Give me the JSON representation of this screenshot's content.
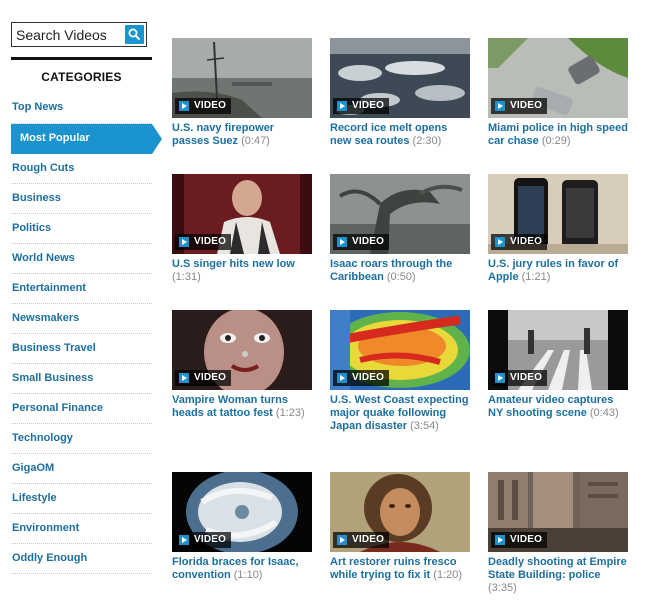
{
  "search": {
    "placeholder": "Search Videos",
    "icon": "search-icon"
  },
  "categories": {
    "title": "CATEGORIES",
    "items": [
      {
        "label": "Top News"
      },
      {
        "label": "Most Popular",
        "active": true
      },
      {
        "label": "Rough Cuts"
      },
      {
        "label": "Business"
      },
      {
        "label": "Politics"
      },
      {
        "label": "World News"
      },
      {
        "label": "Entertainment"
      },
      {
        "label": "Newsmakers"
      },
      {
        "label": "Business Travel"
      },
      {
        "label": "Small Business"
      },
      {
        "label": "Personal Finance"
      },
      {
        "label": "Technology"
      },
      {
        "label": "GigaOM"
      },
      {
        "label": "Lifestyle"
      },
      {
        "label": "Environment"
      },
      {
        "label": "Oddly Enough"
      }
    ]
  },
  "badge_label": "VIDEO",
  "colors": {
    "accent": "#1a93cf",
    "link": "#1c6fa0",
    "duration": "#888888"
  },
  "videos": [
    {
      "title": "U.S. navy firepower passes Suez",
      "duration": "(0:47)"
    },
    {
      "title": "Record ice melt opens new sea routes",
      "duration": "(2:30)"
    },
    {
      "title": "Miami police in high speed car chase",
      "duration": "(0:29)"
    },
    {
      "title": "U.S singer hits new low",
      "duration": "(1:31)"
    },
    {
      "title": "Isaac roars through the Caribbean",
      "duration": "(0:50)"
    },
    {
      "title": "U.S. jury rules in favor of Apple",
      "duration": "(1:21)"
    },
    {
      "title": "Vampire Woman turns heads at tattoo fest",
      "duration": "(1:23)"
    },
    {
      "title": "U.S. West Coast expecting major quake following Japan disaster",
      "duration": "(3:54)"
    },
    {
      "title": "Amateur video captures NY shooting scene",
      "duration": "(0:43)"
    },
    {
      "title": "Florida braces for Isaac, convention",
      "duration": "(1:10)"
    },
    {
      "title": "Art restorer ruins fresco while trying to fix it",
      "duration": "(1:20)"
    },
    {
      "title": "Deadly shooting at Empire State Building: police",
      "duration": "(3:35)"
    }
  ]
}
